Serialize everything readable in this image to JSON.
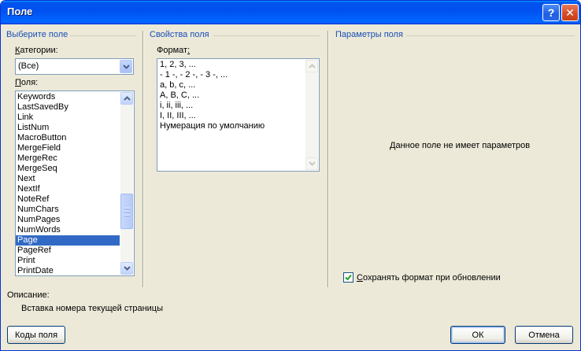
{
  "window": {
    "title": "Поле",
    "help_button": "?",
    "close_button": "✕"
  },
  "select_field": {
    "section_title": "Выберите поле",
    "categories_label_accel": "К",
    "categories_label_rest": "атегории:",
    "categories_value": "(Все)",
    "fields_label_accel": "П",
    "fields_label_rest": "оля:",
    "fields": [
      "Keywords",
      "LastSavedBy",
      "Link",
      "ListNum",
      "MacroButton",
      "MergeField",
      "MergeRec",
      "MergeSeq",
      "Next",
      "NextIf",
      "NoteRef",
      "NumChars",
      "NumPages",
      "NumWords",
      "Page",
      "PageRef",
      "Print",
      "PrintDate"
    ],
    "selected_field": "Page"
  },
  "field_properties": {
    "section_title": "Свойства поля",
    "format_label_pre": "Формат",
    "format_label_accel": ":",
    "formats": [
      "1, 2, 3, ...",
      "- 1 -, - 2 -, - 3 -, ...",
      "a, b, c, ...",
      "A, B, C, ...",
      "i, ii, iii, ...",
      "I, II, III, ...",
      "Нумерация по умолчанию"
    ]
  },
  "field_options": {
    "section_title": "Параметры поля",
    "no_params": "Данное поле не имеет параметров",
    "preserve_label_accel": "С",
    "preserve_label_rest": "охранять формат при обновлении",
    "preserve_checked": true
  },
  "description": {
    "label": "Описание:",
    "text": "Вставка номера текущей страницы"
  },
  "buttons": {
    "field_codes_pre": "Ко",
    "field_codes_accel": "д",
    "field_codes_post": "ы поля",
    "ok": "ОК",
    "cancel": "Отмена"
  },
  "colors": {
    "section_title": "#1a4fb6",
    "selection": "#316ac5",
    "dialog_bg": "#ece9d8",
    "titlebar": "#0053ee"
  },
  "scroll": {
    "fields_thumb_fraction_start": 0.56,
    "fields_thumb_fraction_size": 0.22
  }
}
